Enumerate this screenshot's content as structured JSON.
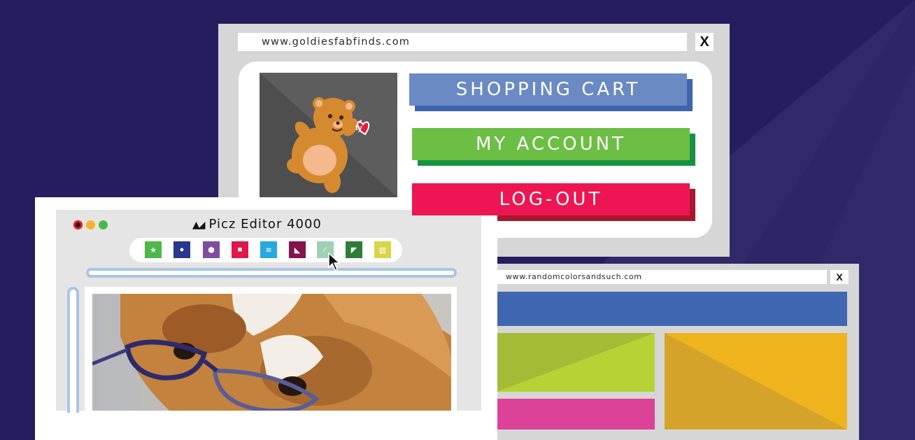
{
  "background": {
    "color": "#251d5e",
    "stripe_color": "#2f2869"
  },
  "shop_window": {
    "url": "www.goldiesfabfinds.com",
    "close_label": "X",
    "product_image": "teddy-bear-plush",
    "brand_tag": "ty",
    "buttons": {
      "cart": "SHOPPING CART",
      "account": "MY ACCOUNT",
      "logout": "LOG-OUT"
    },
    "colors": {
      "cart": "#6a8ac4",
      "account": "#6cbe45",
      "logout": "#ed1653"
    }
  },
  "editor_window": {
    "title": "Picz Editor 4000",
    "traffic_lights": [
      "red",
      "yellow",
      "green"
    ],
    "tools": [
      {
        "name": "star-tool",
        "color": "#4cb848",
        "glyph": "★"
      },
      {
        "name": "circle-tool",
        "color": "#283891",
        "glyph": "●"
      },
      {
        "name": "hexagon-tool",
        "color": "#7f4c9e",
        "glyph": "⬢"
      },
      {
        "name": "square-tool",
        "color": "#e0174b",
        "glyph": "■"
      },
      {
        "name": "layers-tool",
        "color": "#26a9e0",
        "glyph": "≋"
      },
      {
        "name": "arrow-tool",
        "color": "#84144a",
        "glyph": "◣"
      },
      {
        "name": "pen-tool",
        "color": "#9fd0b2",
        "glyph": "⁄"
      },
      {
        "name": "shape-tool",
        "color": "#2e7c36",
        "glyph": "◤"
      },
      {
        "name": "gradient-tool",
        "color": "#d8d54a",
        "glyph": "▧"
      }
    ],
    "photo_subject": "dog-with-glasses"
  },
  "colors_window": {
    "url": "www.randomcolorsandsuch.com",
    "close_label": "X",
    "blocks": {
      "header": "#3f67b1",
      "lime": "#b5d334",
      "pink": "#db4298",
      "yellow": "#efb41d"
    }
  }
}
